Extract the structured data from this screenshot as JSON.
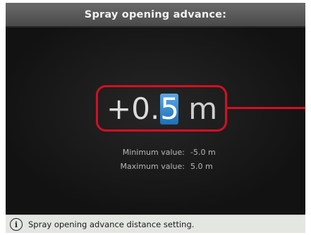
{
  "header": {
    "title": "Spray opening advance:"
  },
  "editor": {
    "sign": "+",
    "integer": "0",
    "decimal_point": ".",
    "selected_digit": "5",
    "unit": "m"
  },
  "limits": {
    "min_label": "Minimum value:",
    "min_value": "-5.0 m",
    "max_label": "Maximum value:",
    "max_value": "5.0 m"
  },
  "status": {
    "icon": "info-icon",
    "text": "Spray opening advance distance setting."
  },
  "colors": {
    "highlight": "#d40f24",
    "selected_digit_bg": "#2f86d0",
    "screen_bg": "#141414"
  }
}
